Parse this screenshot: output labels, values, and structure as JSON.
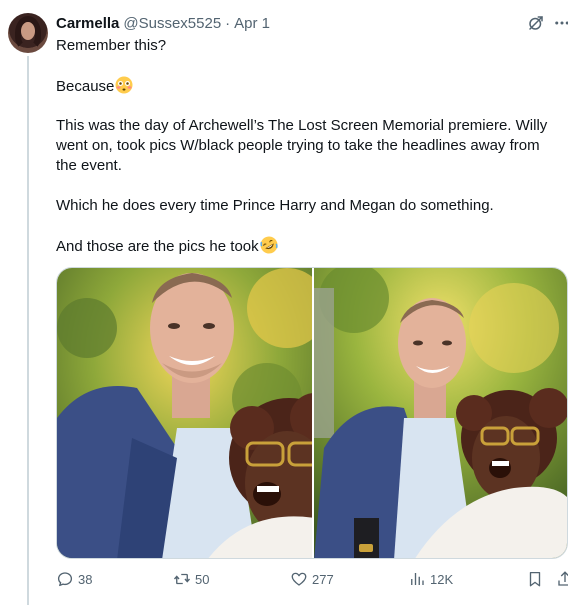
{
  "tweet": {
    "author_name": "Carmella",
    "author_handle": "@Sussex5525",
    "separator": "·",
    "date": "Apr 1",
    "text": {
      "line1": "Remember this?",
      "line2": "Because",
      "line3": "This was the day of Archewell’s The Lost Screen Memorial premiere. Willy went on, took pics W/black people trying to take the headlines away from the event.",
      "line4": "Which he does every time Prince Harry and Megan do something.",
      "line5": "And those are the pics he took"
    },
    "emojis": [
      "flushed-face-emoji",
      "rolling-on-floor-laughing-emoji"
    ],
    "media": [
      "photo-1",
      "photo-2"
    ]
  },
  "actions": {
    "replies": "38",
    "retweets": "50",
    "likes": "277",
    "views": "12K"
  },
  "icons": {
    "reply": "reply-icon",
    "retweet": "retweet-icon",
    "like": "heart-icon",
    "views": "views-icon",
    "bookmark": "bookmark-icon",
    "share": "share-icon",
    "grok": "grok-icon",
    "more": "more-icon"
  },
  "colors": {
    "text": "#0f1419",
    "secondary": "#536471",
    "border": "#cfd9de"
  }
}
